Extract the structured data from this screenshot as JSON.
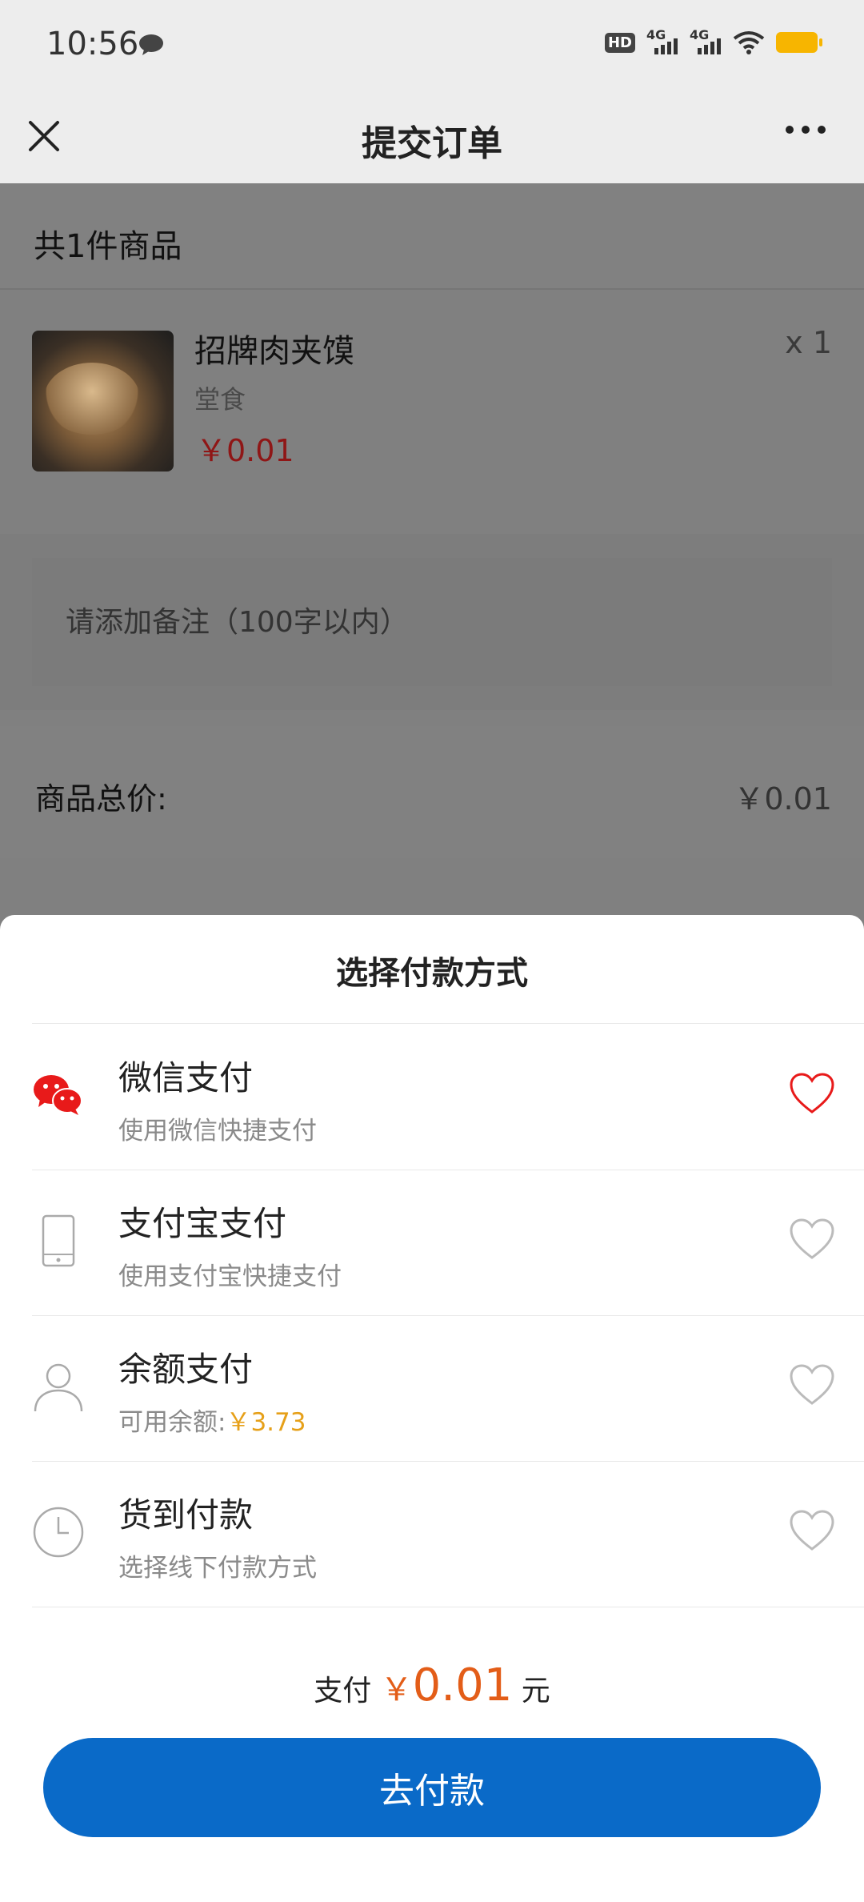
{
  "status_bar": {
    "time": "10:56",
    "network_1": "4G",
    "network_2": "4G",
    "hd": "HD"
  },
  "nav": {
    "title": "提交订单"
  },
  "order": {
    "count_text": "共1件商品",
    "product": {
      "name": "招牌肉夹馍",
      "type": "堂食",
      "price": "￥0.01",
      "qty": "x 1"
    },
    "remark_placeholder": "请添加备注（100字以内）",
    "total_label": "商品总价:",
    "total_value": "￥0.01"
  },
  "payment_sheet": {
    "title": "选择付款方式",
    "methods": [
      {
        "title": "微信支付",
        "subtitle": "使用微信快捷支付",
        "icon": "wechat-icon",
        "selected": true
      },
      {
        "title": "支付宝支付",
        "subtitle": "使用支付宝快捷支付",
        "icon": "phone-icon",
        "selected": false
      },
      {
        "title": "余额支付",
        "subtitle": "可用余额:",
        "balance": "￥3.73",
        "icon": "user-icon",
        "selected": false
      },
      {
        "title": "货到付款",
        "subtitle": "选择线下付款方式",
        "icon": "clock-icon",
        "selected": false
      }
    ],
    "summary_prefix": "支付",
    "summary_currency": "￥",
    "summary_amount": "0.01",
    "summary_suffix": "元",
    "pay_button": "去付款"
  },
  "colors": {
    "accent_blue": "#0a6ac8",
    "price_orange": "#e35d18",
    "balance_yellow": "#e6a019",
    "wechat_red": "#e81a1a"
  }
}
